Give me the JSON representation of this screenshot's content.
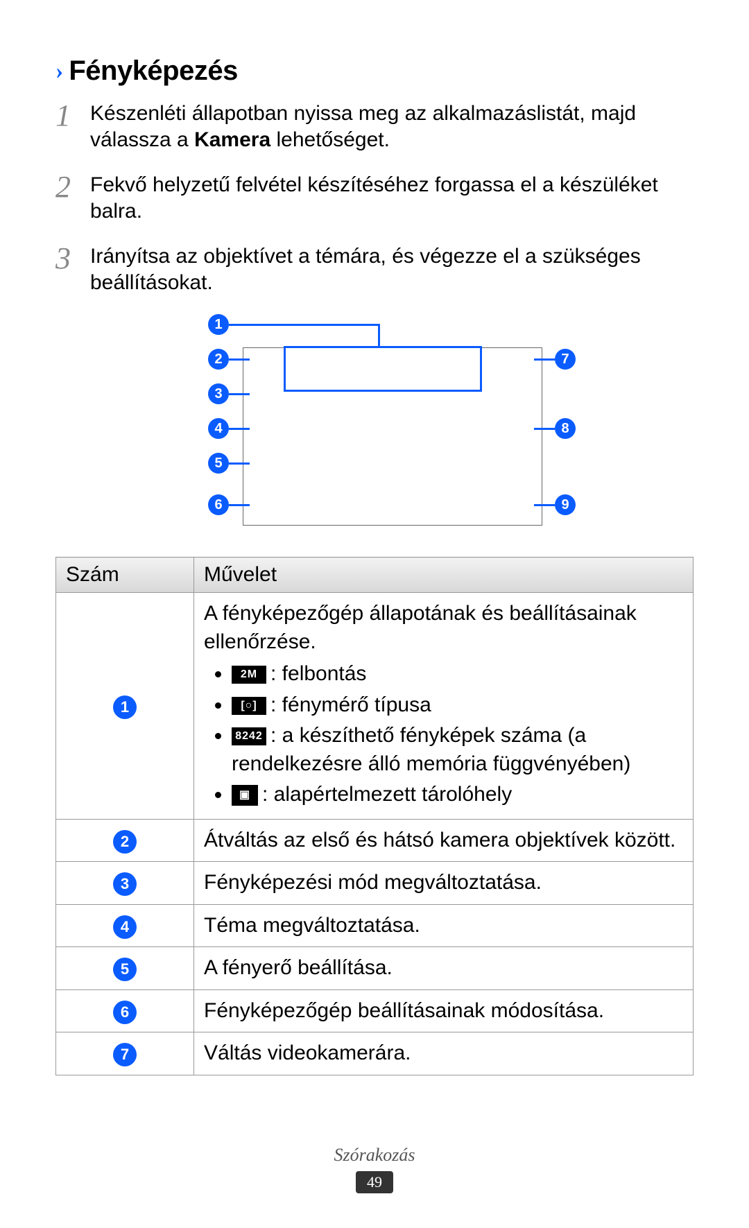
{
  "heading": "Fényképezés",
  "steps": [
    {
      "pre": "Készenléti állapotban nyissa meg az alkalmazáslistát, majd válassza a ",
      "bold": "Kamera",
      "post": " lehetőséget."
    },
    {
      "text": "Fekvő helyzetű felvétel készítéséhez forgassa el a készüléket balra."
    },
    {
      "text": "Irányítsa az objektívet a témára, és végezze el a szükséges beállításokat."
    }
  ],
  "diagram_labels": [
    "1",
    "2",
    "3",
    "4",
    "5",
    "6",
    "7",
    "8",
    "9"
  ],
  "table": {
    "head_num": "Szám",
    "head_op": "Művelet",
    "rows": [
      {
        "num": "1",
        "op_intro": "A fényképezőgép állapotának és beállításainak ellenőrzése.",
        "sub": [
          {
            "icon": "2M",
            "text": ": felbontás"
          },
          {
            "icon": "[○]",
            "text": ": fénymérő típusa"
          },
          {
            "icon": "8242",
            "text": ": a készíthető fényképek száma (a rendelkezésre álló memória függvényében)"
          },
          {
            "icon": "▣",
            "text": ": alapértelmezett tárolóhely"
          }
        ]
      },
      {
        "num": "2",
        "op": "Átváltás az első és hátsó kamera objektívek között."
      },
      {
        "num": "3",
        "op": "Fényképezési mód megváltoztatása."
      },
      {
        "num": "4",
        "op": "Téma megváltoztatása."
      },
      {
        "num": "5",
        "op": "A fényerő beállítása."
      },
      {
        "num": "6",
        "op": "Fényképezőgép beállításainak módosítása."
      },
      {
        "num": "7",
        "op": "Váltás videokamerára."
      }
    ]
  },
  "footer_section": "Szórakozás",
  "page_number": "49"
}
